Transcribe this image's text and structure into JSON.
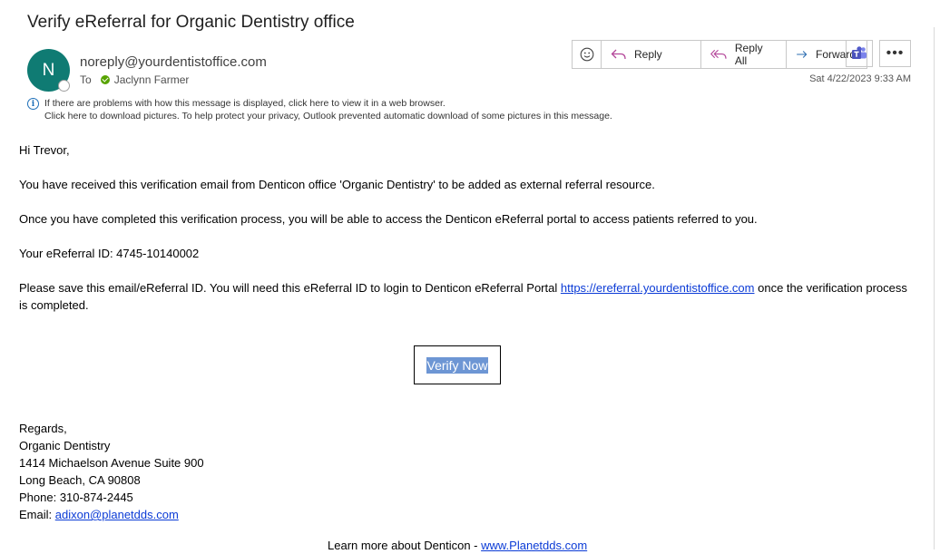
{
  "email": {
    "subject": "Verify eReferral for Organic Dentistry office",
    "avatar_initial": "N",
    "sender": "noreply@yourdentistoffice.com",
    "to_label": "To",
    "recipient": "Jaclynn Farmer",
    "date": "Sat 4/22/2023 9:33 AM",
    "info_line1": "If there are problems with how this message is displayed, click here to view it in a web browser.",
    "info_line2": "Click here to download pictures. To help protect your privacy, Outlook prevented automatic download of some pictures in this message."
  },
  "toolbar": {
    "emoji_icon": "smiley-icon",
    "reply_label": "Reply",
    "reply_all_label": "Reply All",
    "forward_label": "Forward",
    "teams_icon": "teams-icon",
    "more_label": "•••",
    "accent": "#b4479a",
    "forward_color": "#2b6cb0"
  },
  "body": {
    "greeting": "Hi Trevor,",
    "para1": "You have received this verification email from Denticon office 'Organic Dentistry' to be added as external referral resource.",
    "para2": "Once you have completed this verification process, you will be able to access the Denticon eReferral portal to access patients referred to you.",
    "id_line": "Your eReferral ID: 4745-10140002",
    "para3_before": "Please save this email/eReferral ID. You will need this eReferral ID to login to Denticon eReferral Portal ",
    "para3_link": "https://ereferral.yourdentistoffice.com",
    "para3_after": " once the verification process is completed.",
    "verify_button": "Verify Now"
  },
  "signature": {
    "regards": "Regards,",
    "org": "Organic Dentistry",
    "address1": "1414 Michaelson Avenue Suite 900",
    "address2": "Long Beach, CA 90808",
    "phone": "Phone: 310-874-2445",
    "email_label": "Email: ",
    "email_link": "adixon@planetdds.com"
  },
  "footer": {
    "text": "Learn more about Denticon - ",
    "link": "www.Planetdds.com"
  }
}
